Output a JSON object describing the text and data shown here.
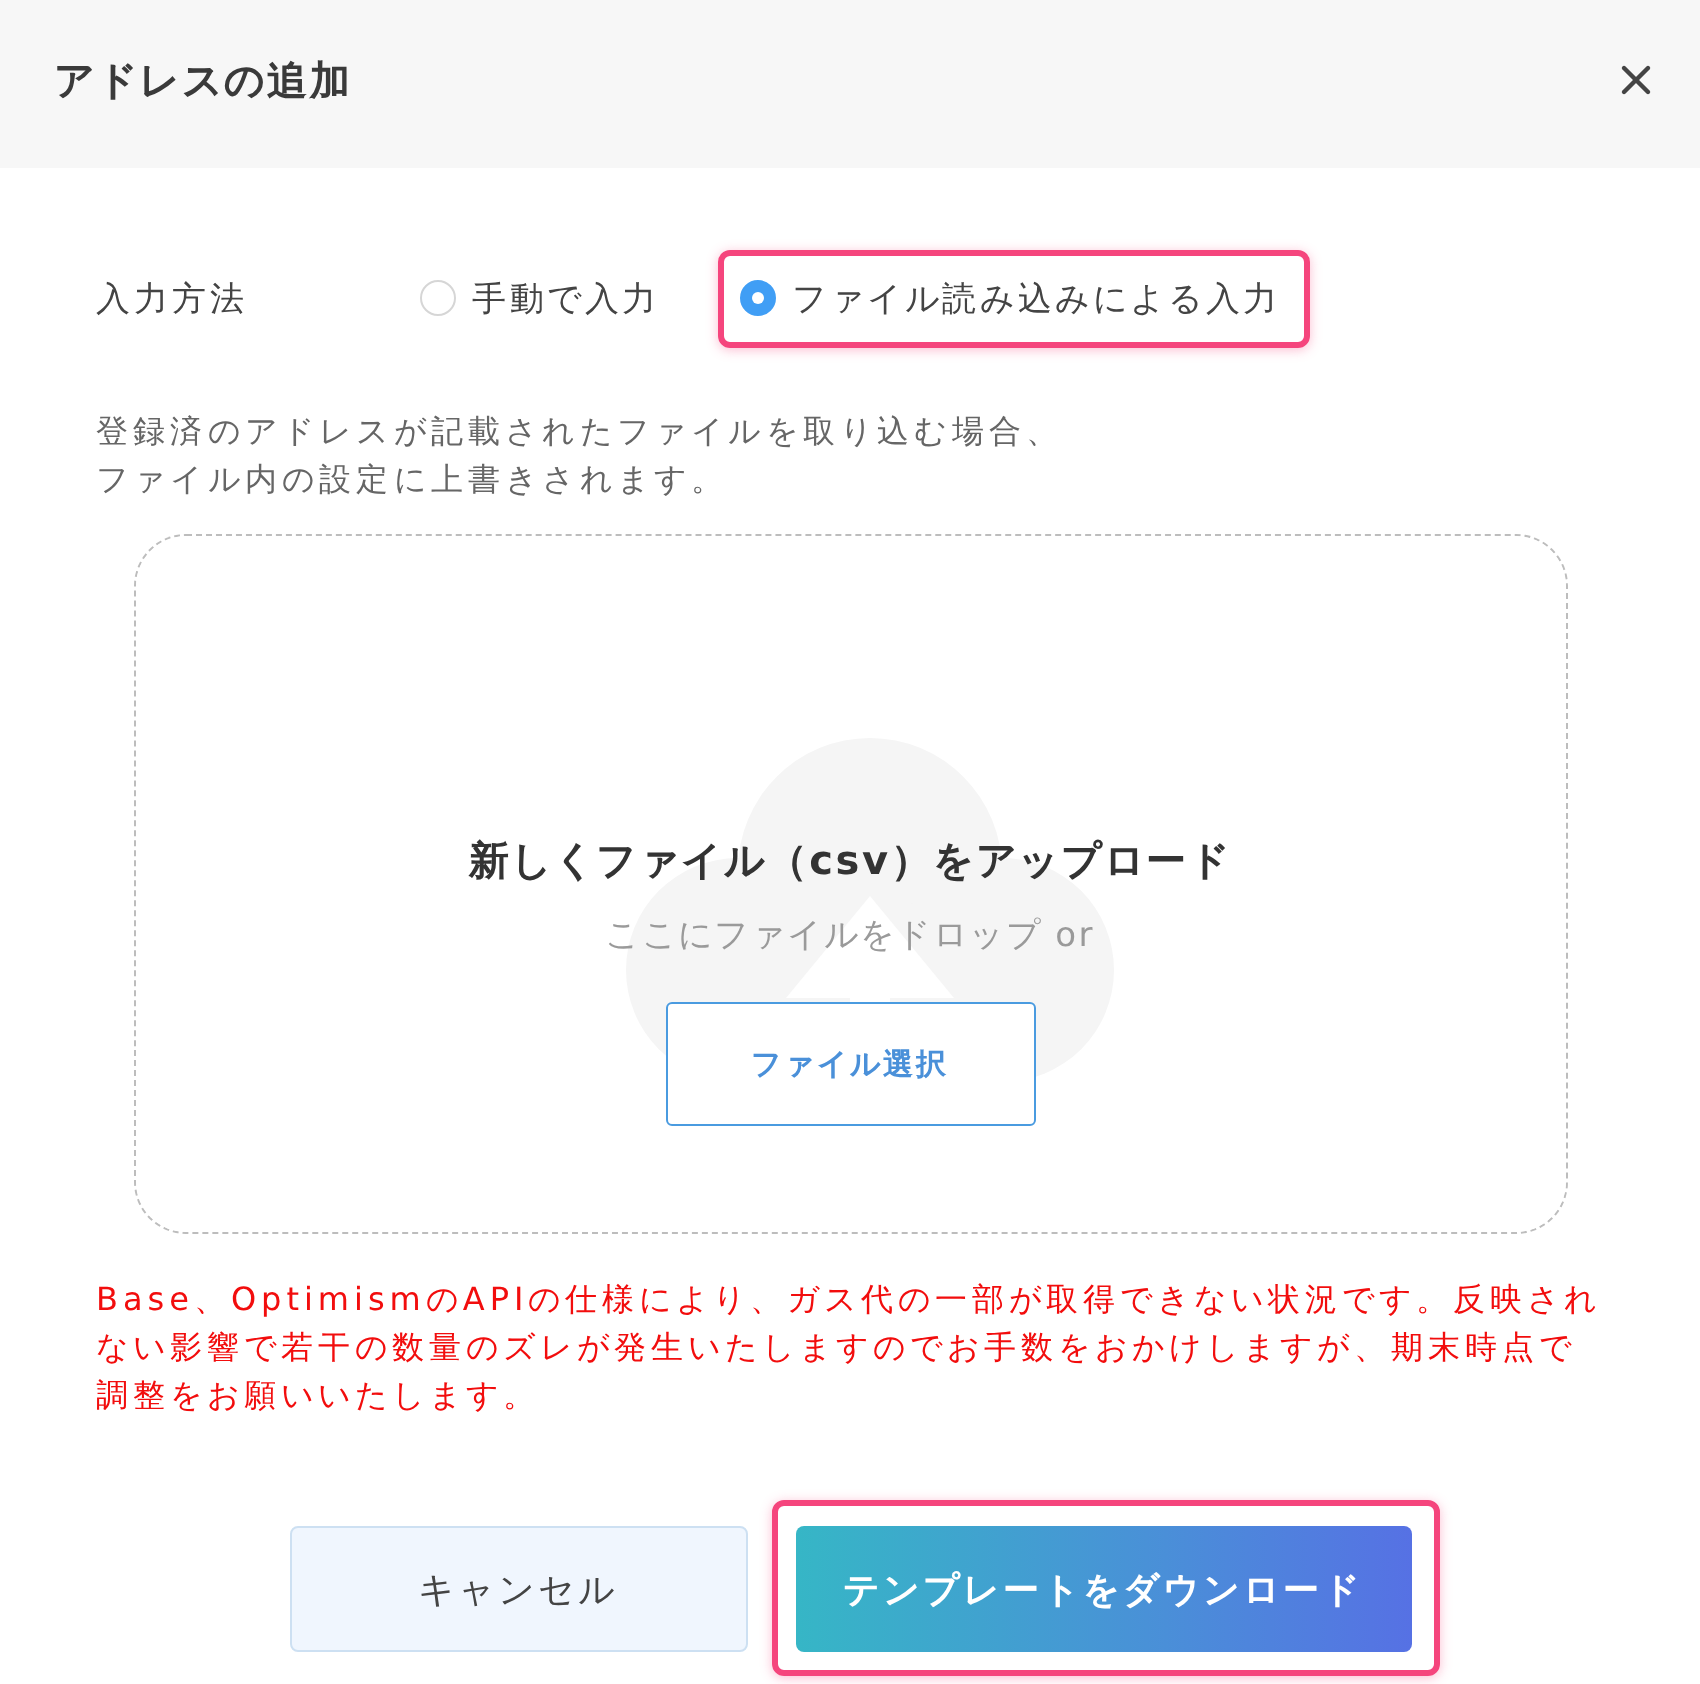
{
  "dialog": {
    "title": "アドレスの追加"
  },
  "input_method": {
    "label": "入力方法",
    "options": [
      {
        "label": "手動で入力",
        "selected": false,
        "highlighted": false
      },
      {
        "label": "ファイル読み込みによる入力",
        "selected": true,
        "highlighted": true
      }
    ]
  },
  "description": [
    "登録済のアドレスが記載されたファイルを取り込む場合、",
    "ファイル内の設定に上書きされます。"
  ],
  "dropzone": {
    "title": "新しくファイル（csv）をアップロード",
    "hint": "ここにファイルをドロップ or",
    "button": "ファイル選択"
  },
  "warning": "Base、OptimismのAPIの仕様により、ガス代の一部が取得できない状況です。反映されない影響で若干の数量のズレが発生いたしますのでお手数をおかけしますが、期末時点で調整をお願いいたします。",
  "buttons": [
    {
      "label": "キャンセル",
      "kind": "secondary",
      "highlighted": false
    },
    {
      "label": "テンプレートをダウンロード",
      "kind": "primary",
      "highlighted": true
    }
  ]
}
